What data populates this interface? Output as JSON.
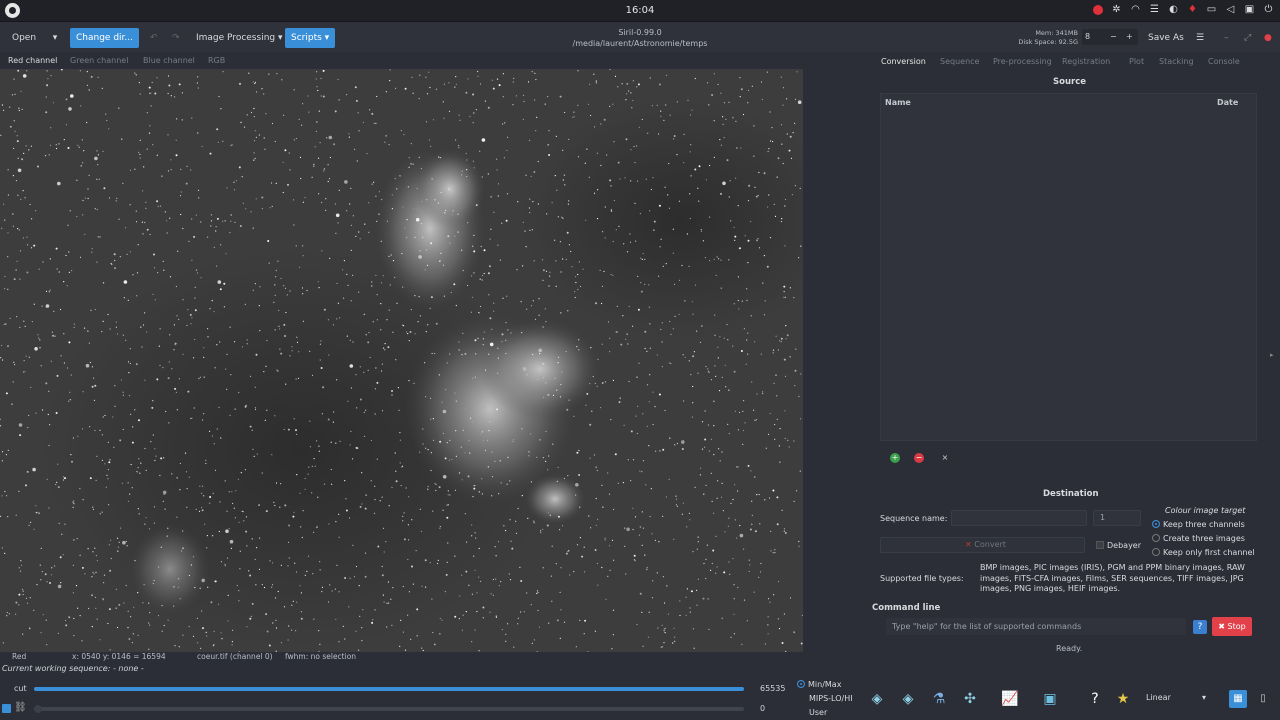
{
  "system": {
    "clock": "16:04"
  },
  "toolbar": {
    "open_label": "Open",
    "change_dir_label": "Change dir...",
    "image_processing_label": "Image Processing",
    "scripts_label": "Scripts",
    "app_title": "Siril-0.99.0",
    "working_dir": "/media/laurent/Astronomie/temps",
    "mem": "Mem: 341MB",
    "disk": "Disk Space: 92.5G",
    "spin_value": "8",
    "save_as_label": "Save As"
  },
  "channel_tabs": [
    "Red channel",
    "Green channel",
    "Blue channel",
    "RGB"
  ],
  "right_tabs": [
    "Conversion",
    "Sequence",
    "Pre-processing",
    "Registration",
    "Plot",
    "Stacking",
    "Console"
  ],
  "conversion": {
    "source_heading": "Source",
    "col_name": "Name",
    "col_date": "Date",
    "destination_heading": "Destination",
    "sequence_name_label": "Sequence name:",
    "sequence_name_value": "",
    "start_index": "1",
    "convert_label": "Convert",
    "debayer_label": "Debayer",
    "colour_target_title": "Colour image target",
    "colour_options": [
      "Keep three channels",
      "Create three images",
      "Keep only first channel"
    ],
    "supported_label": "Supported file types:",
    "supported_text": "BMP images, PIC images (IRIS), PGM and PPM binary images, RAW images, FITS-CFA images, Films, SER sequences, TIFF images, JPG images, PNG images, HEIF images."
  },
  "command": {
    "heading": "Command line",
    "placeholder": "Type \"help\" for the list of supported commands",
    "stop_label": "Stop",
    "help_label": "?",
    "status": "Ready."
  },
  "infobar": {
    "channel": "Red",
    "coords": "x: 0540 y: 0146 = 16594",
    "file": "coeur.tif (channel 0)",
    "fwhm": "fwhm: no selection"
  },
  "working_sequence": "Current working sequence: - none -",
  "display": {
    "cut_label": "cut",
    "hi_value": "65535",
    "lo_value": "0",
    "hi_fraction": 1.0,
    "lo_fraction": 0.0,
    "modes": [
      "Min/Max",
      "MIPS-LO/HI",
      "User"
    ],
    "selected_mode": "Min/Max",
    "stretch": "Linear"
  },
  "colors": {
    "accent": "#3a8fd9",
    "stop": "#e3414a",
    "record": "#e0303a"
  }
}
